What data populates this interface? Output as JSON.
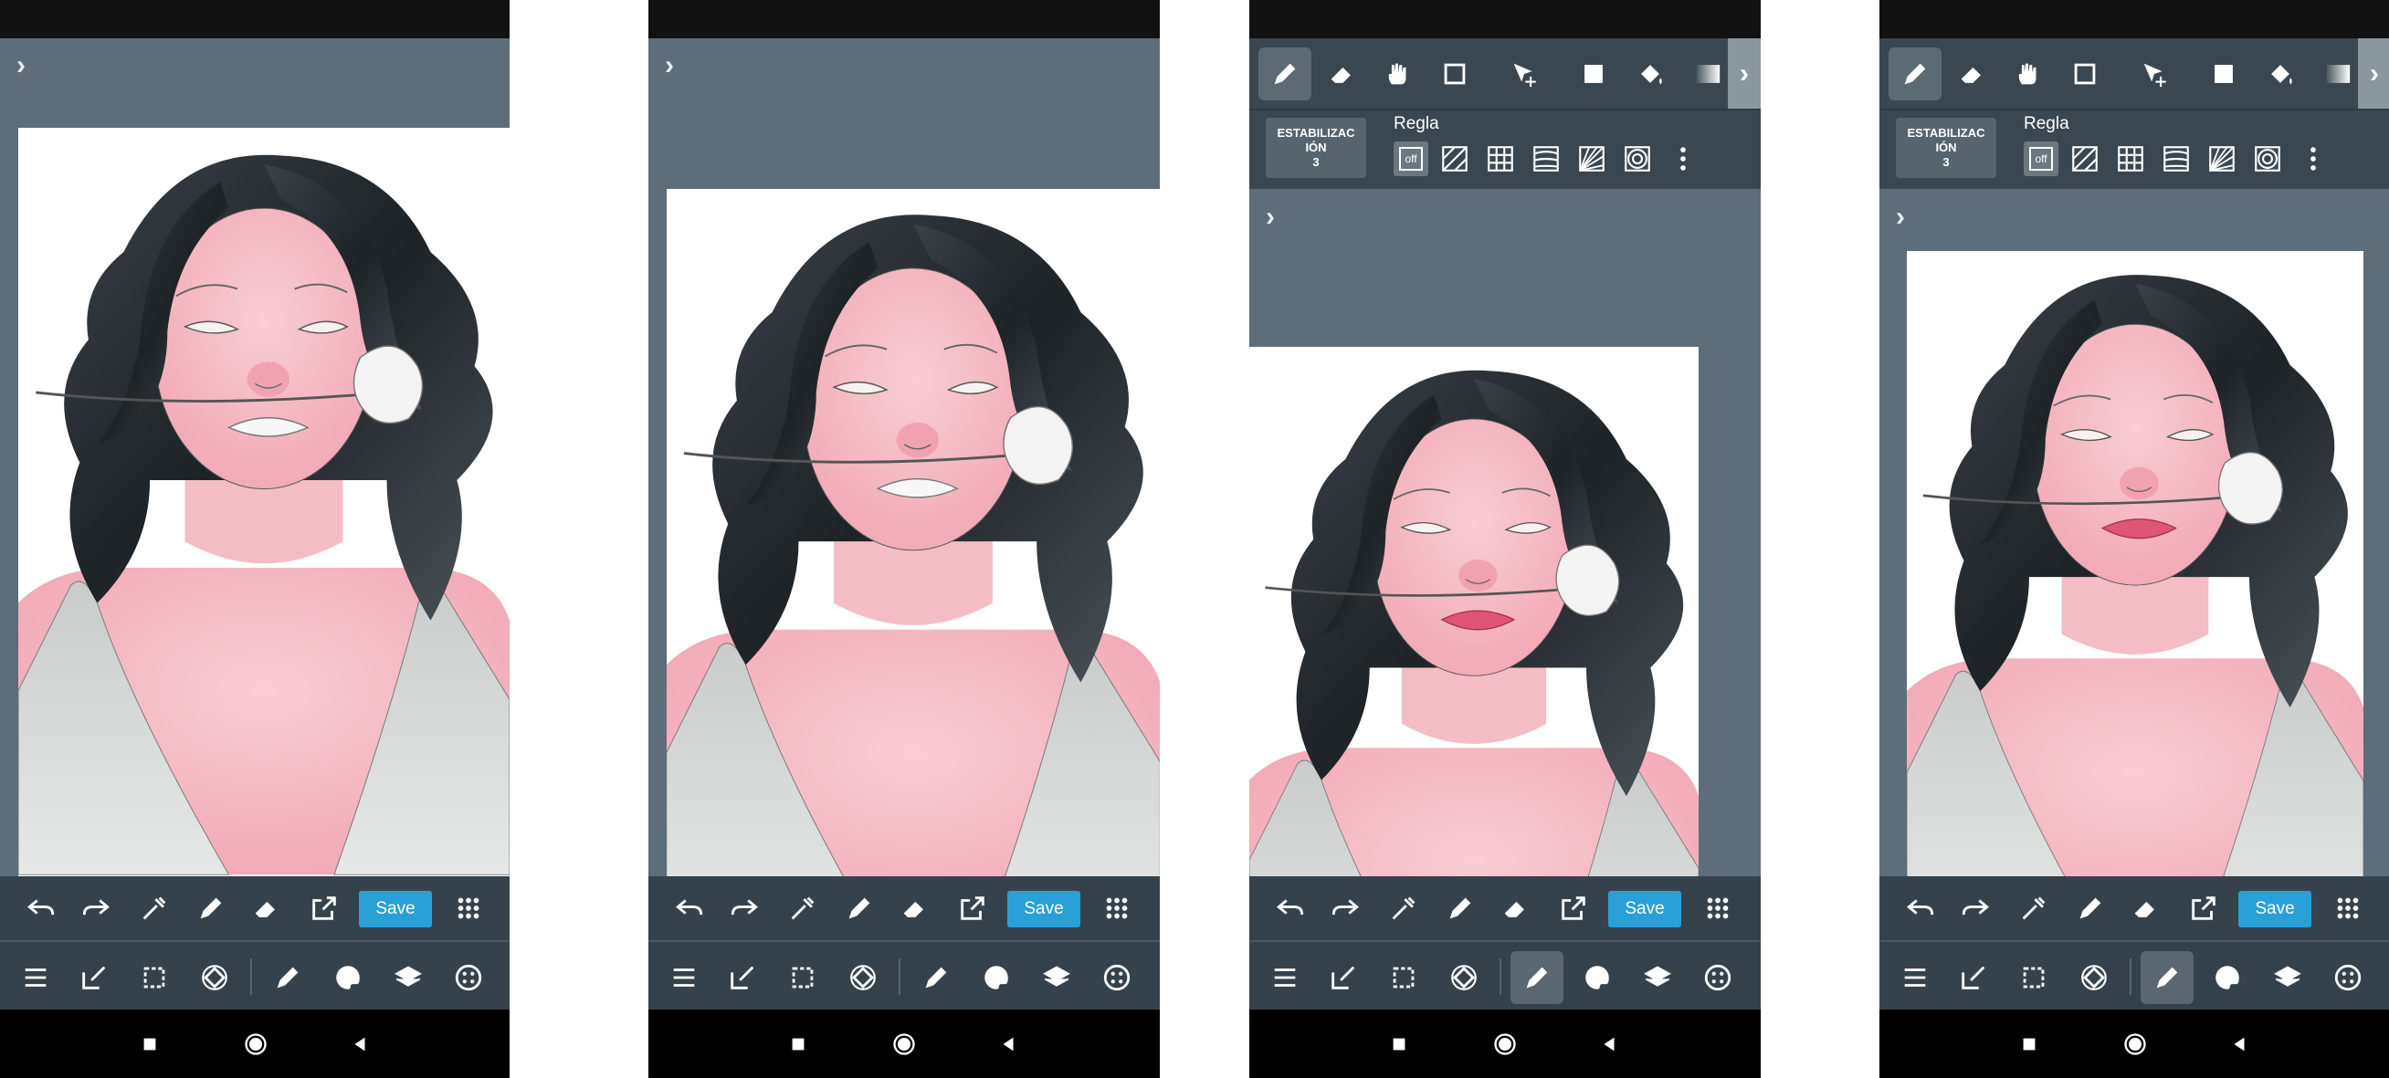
{
  "screens": [
    {
      "id": "p1",
      "toolbar": {
        "save_label": "Save"
      }
    },
    {
      "id": "p2",
      "toolbar": {
        "save_label": "Save"
      }
    },
    {
      "id": "p3",
      "toolbar": {
        "save_label": "Save"
      },
      "stabilizer": {
        "label": "ESTABILIZAC IÓN",
        "value": "3"
      },
      "ruler": {
        "title": "Regla",
        "off_label": "off"
      }
    },
    {
      "id": "p4",
      "toolbar": {
        "save_label": "Save"
      },
      "stabilizer": {
        "label": "ESTABILIZAC IÓN",
        "value": "3"
      },
      "ruler": {
        "title": "Regla",
        "off_label": "off"
      }
    }
  ],
  "icons": {
    "expand": "chevron-right-icon",
    "chevron_glyph": "›",
    "toolbar_top": [
      "undo-icon",
      "redo-icon",
      "eyedropper-icon",
      "pen-icon",
      "eraser-icon",
      "export-icon",
      "save-button",
      "grid-menu-icon"
    ],
    "toolbar_bottom": [
      "menu-icon",
      "edit-icon",
      "selection-icon",
      "transform-icon",
      "brush-icon",
      "palette-icon",
      "layers-icon",
      "materials-icon"
    ],
    "tools_row": [
      "pen-tool-icon",
      "eraser-tool-icon",
      "hand-tool-icon",
      "rectangle-tool-icon",
      "move-tool-icon",
      "fill-color-icon",
      "bucket-icon",
      "gradient-icon"
    ]
  },
  "colors": {
    "panel": "#36424b",
    "background": "#5d6d7a",
    "accent": "#2aa0d8",
    "skin": "#f4c0c8",
    "hair": "#24292d",
    "lips_white": "#f5f5f5",
    "lips_pink": "#e05575"
  }
}
